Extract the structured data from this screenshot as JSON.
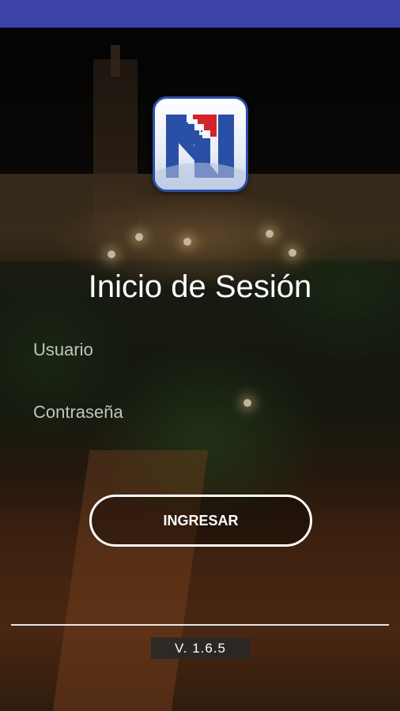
{
  "app": {
    "logo_icon": "app-logo-n-icon",
    "brand_colors": {
      "primary": "#2a4fa6",
      "accent": "#d4232b",
      "status_bar": "#3b43a8"
    }
  },
  "login": {
    "title": "Inicio de Sesión",
    "username_placeholder": "Usuario",
    "password_placeholder": "Contraseña",
    "submit_label": "INGRESAR"
  },
  "footer": {
    "version": "V. 1.6.5"
  }
}
